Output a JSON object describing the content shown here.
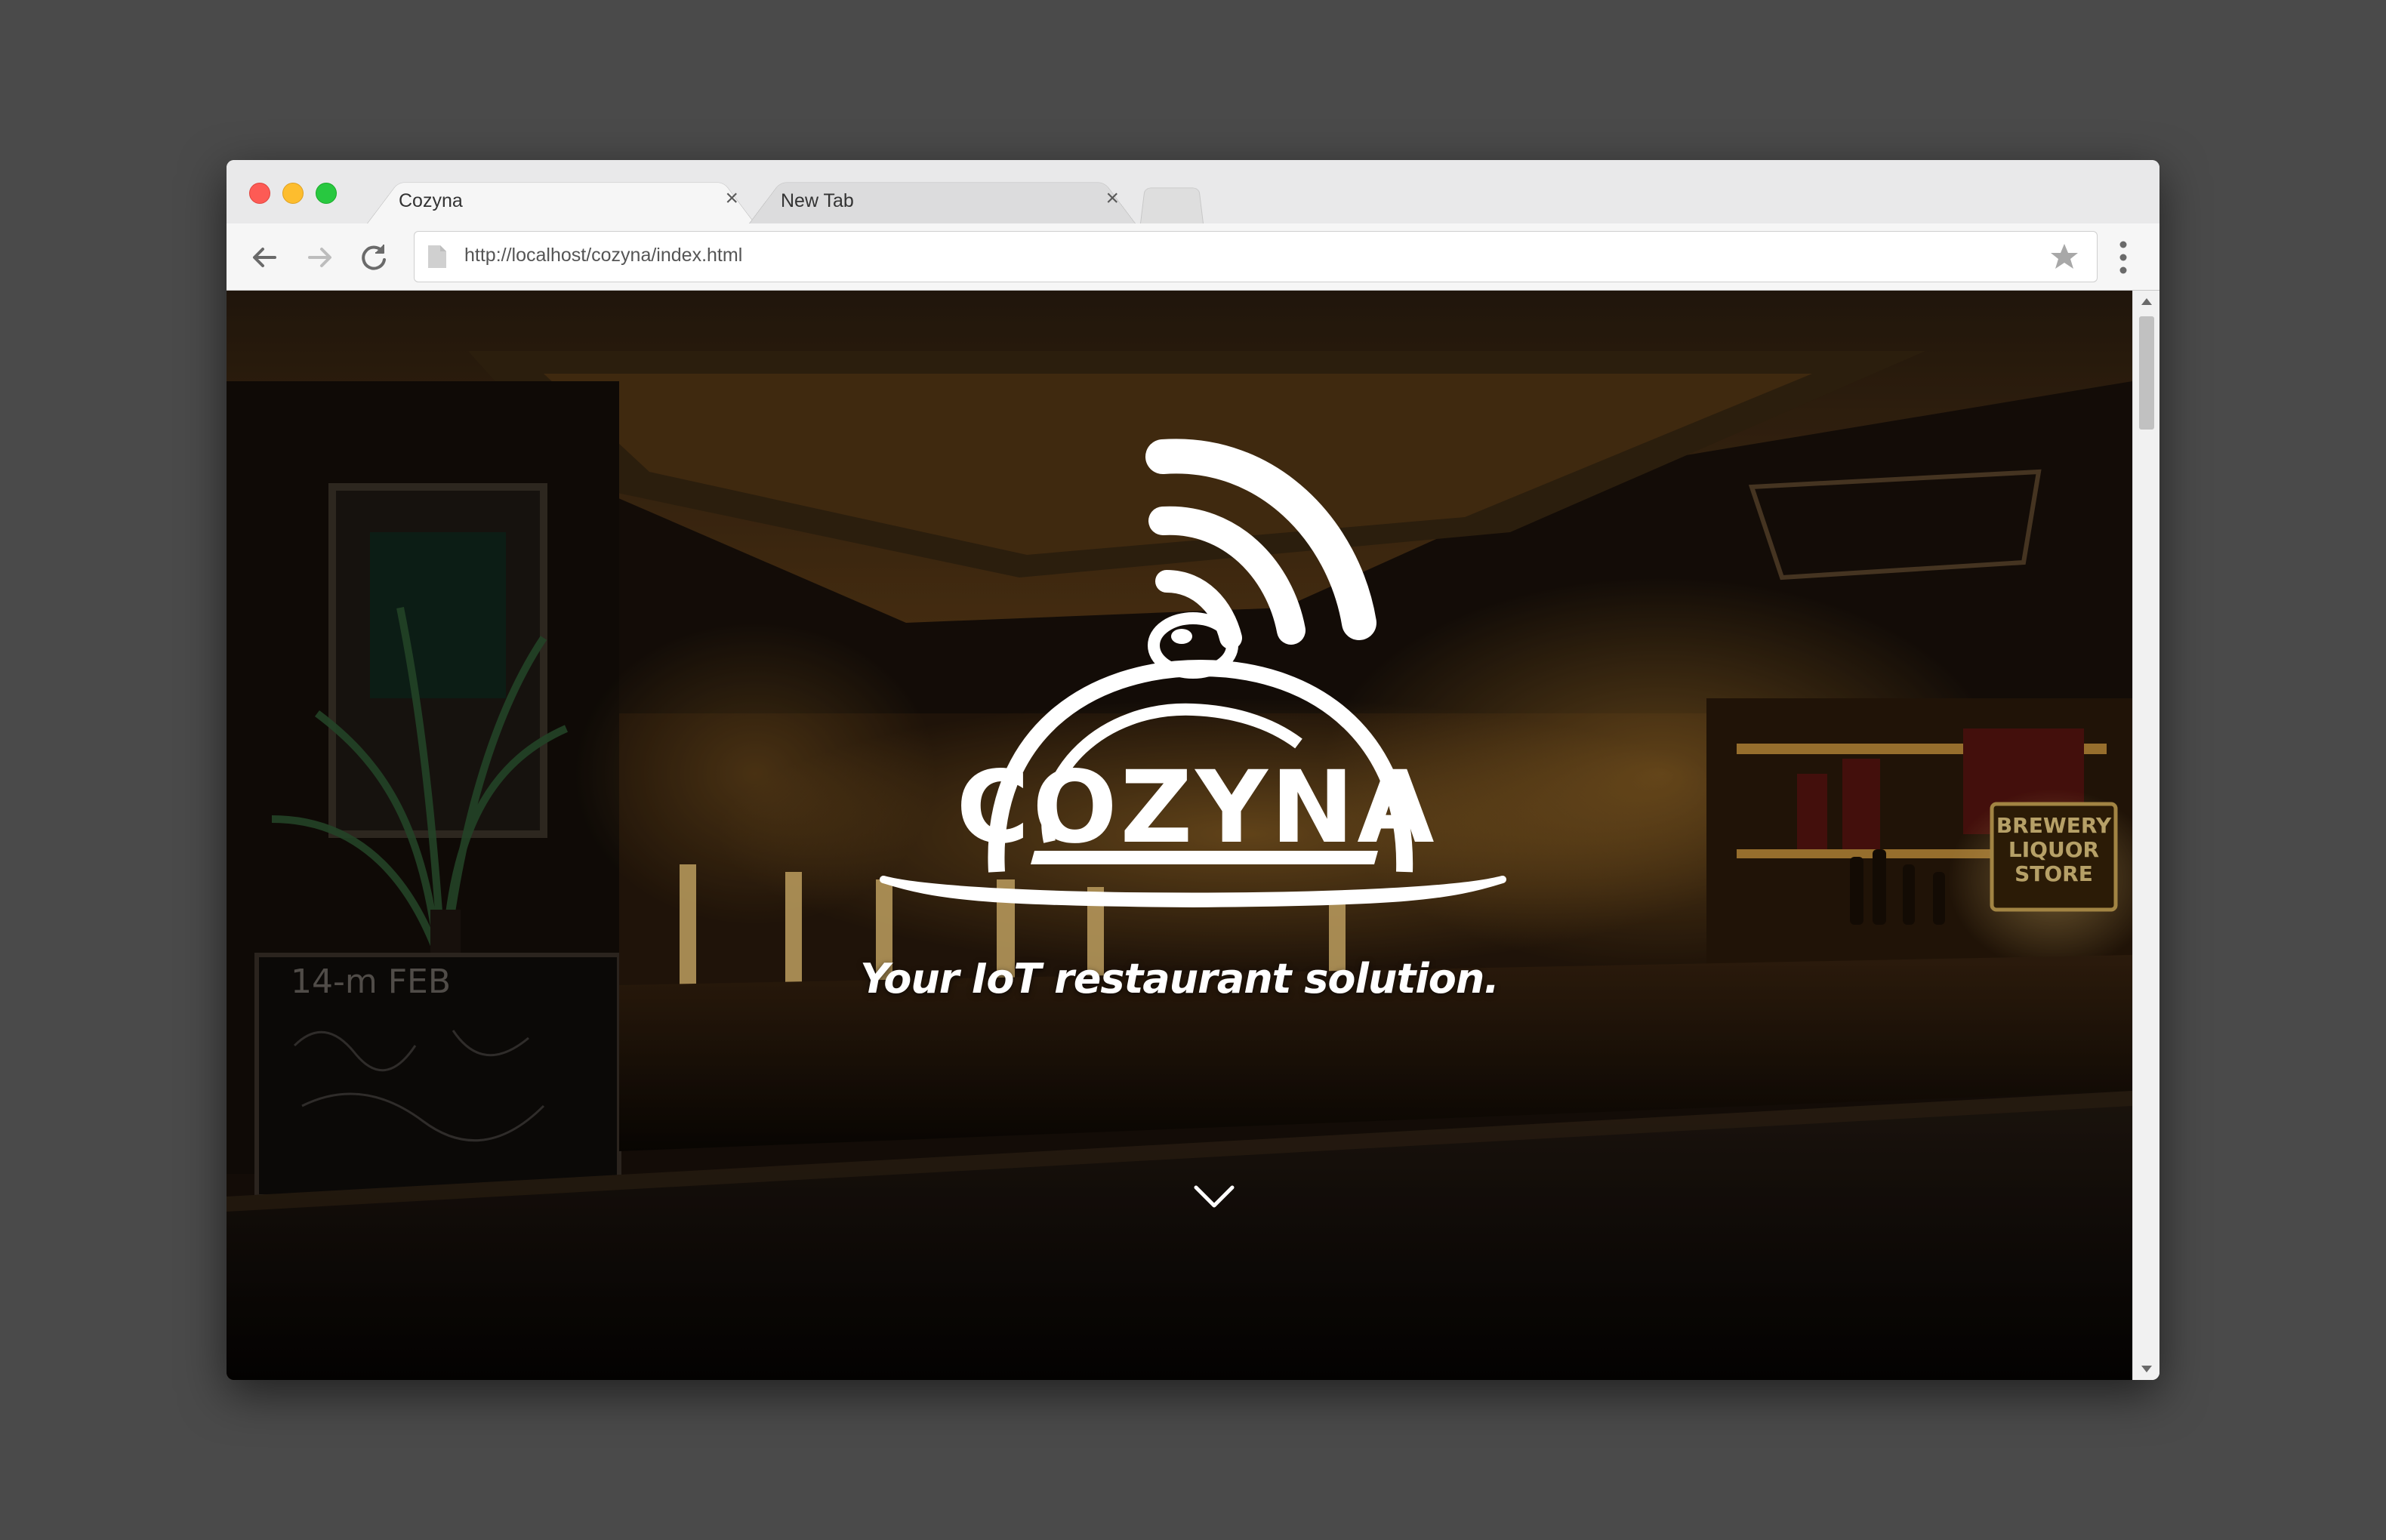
{
  "browser": {
    "tabs": [
      {
        "title": "Cozyna",
        "active": true
      },
      {
        "title": "New Tab",
        "active": false
      }
    ],
    "address_bar": {
      "url": "http://localhost/cozyna/index.html"
    }
  },
  "page": {
    "logo_text": "COZYNA",
    "tagline": "Your IoT restaurant solution.",
    "scene_signs": {
      "brewery": [
        "BREWERY",
        "LIQUOR",
        "STORE"
      ],
      "chalkboard": "14-m FEB"
    }
  },
  "colors": {
    "traffic_red": "#fd5b55",
    "traffic_yellow": "#fdbd2e",
    "traffic_green": "#28c840",
    "logo": "#ffffff"
  },
  "icons": {
    "back": "arrow-left-icon",
    "forward": "arrow-right-icon",
    "reload": "reload-icon",
    "page": "page-icon",
    "bookmark": "star-icon",
    "menu": "kebab-menu-icon",
    "scroll_down": "chevron-down-icon"
  }
}
